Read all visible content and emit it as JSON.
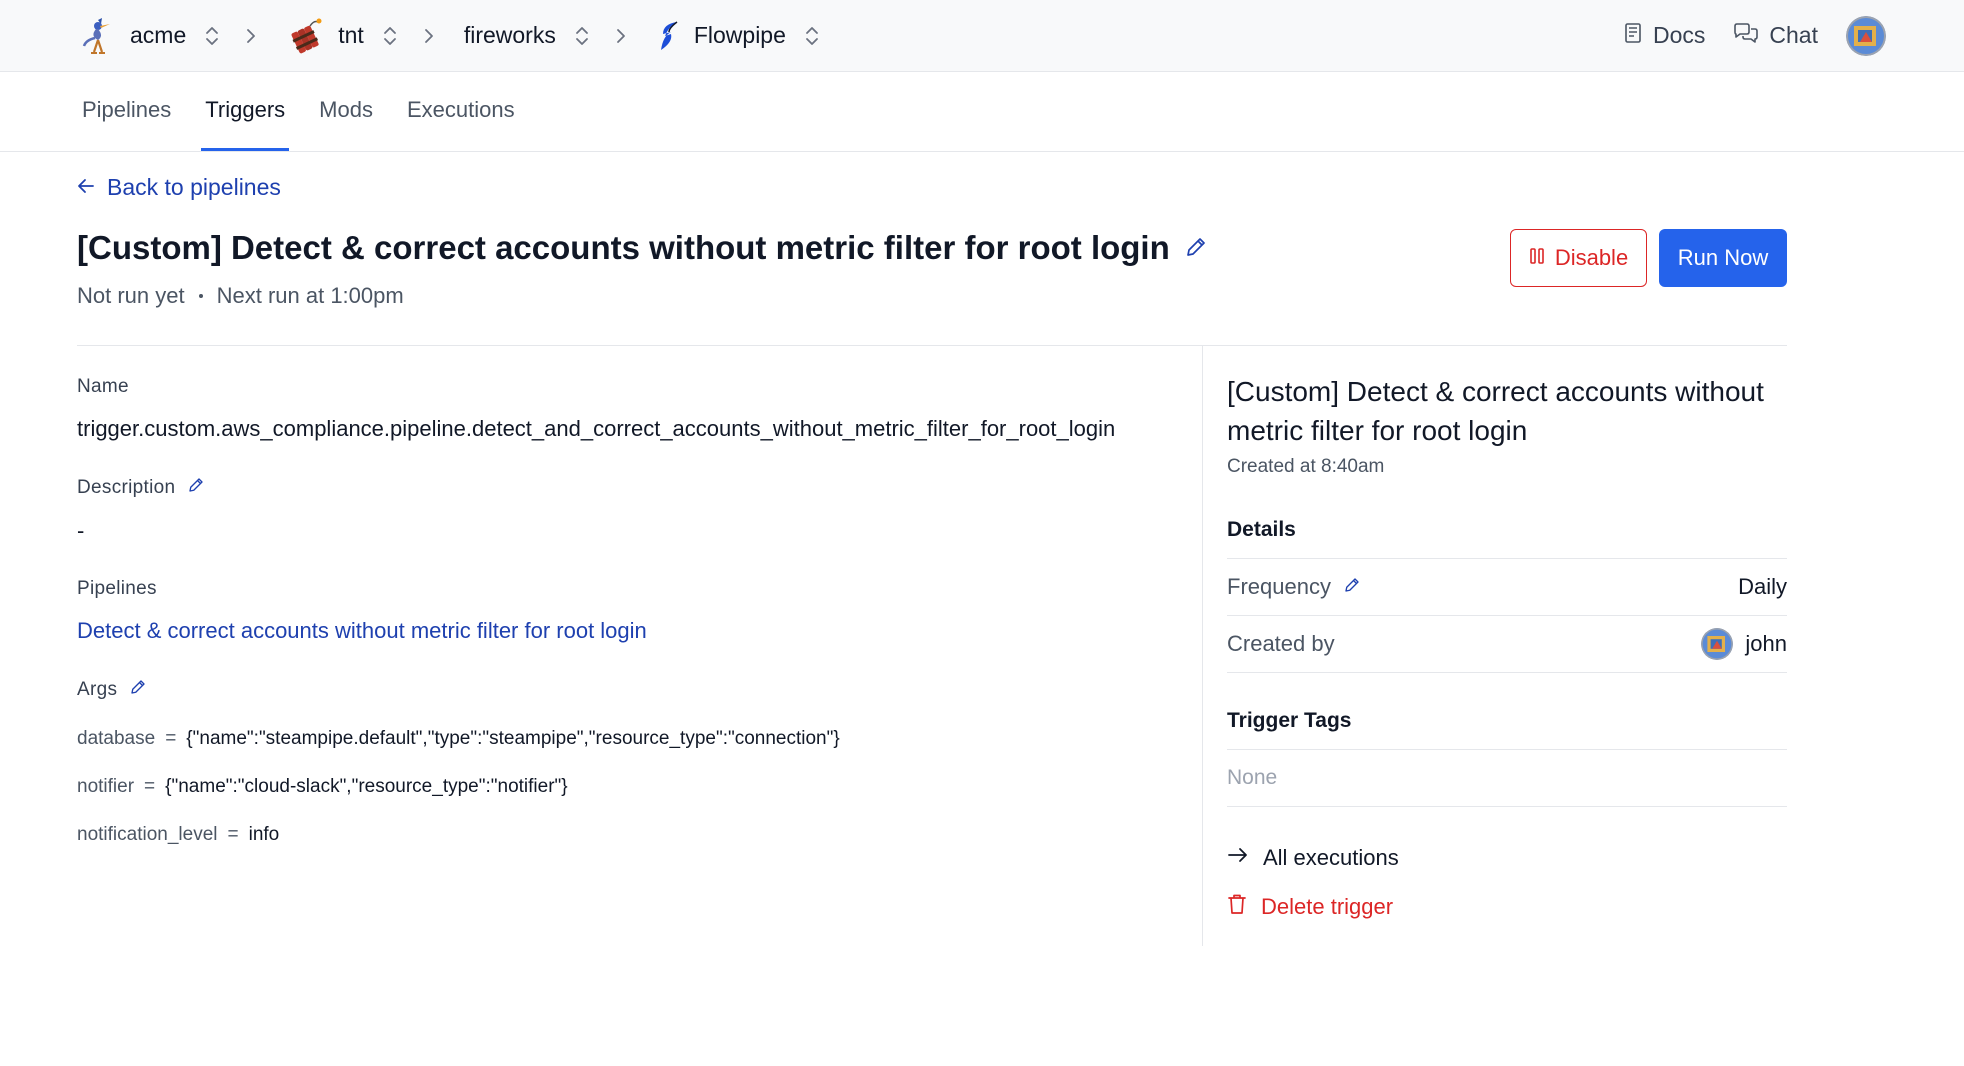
{
  "breadcrumb": {
    "items": [
      {
        "label": "acme",
        "icon": "roadrunner-logo-icon"
      },
      {
        "label": "tnt",
        "icon": "dynamite-logo-icon"
      },
      {
        "label": "fireworks",
        "icon": ""
      },
      {
        "label": "Flowpipe",
        "icon": "flowpipe-logo-icon"
      }
    ]
  },
  "topnav": {
    "docs_label": "Docs",
    "chat_label": "Chat"
  },
  "tabs": [
    {
      "label": "Pipelines",
      "active": false
    },
    {
      "label": "Triggers",
      "active": true
    },
    {
      "label": "Mods",
      "active": false
    },
    {
      "label": "Executions",
      "active": false
    }
  ],
  "page": {
    "back_label": "Back to pipelines",
    "title": "[Custom] Detect & correct accounts without metric filter for root login",
    "status": "Not run yet",
    "next_run": "Next run at 1:00pm",
    "disable_label": "Disable",
    "run_now_label": "Run Now"
  },
  "details": {
    "name_label": "Name",
    "name_value": "trigger.custom.aws_compliance.pipeline.detect_and_correct_accounts_without_metric_filter_for_root_login",
    "description_label": "Description",
    "description_value": "-",
    "pipelines_label": "Pipelines",
    "pipeline_link": "Detect & correct accounts without metric filter for root login",
    "args_label": "Args",
    "args": [
      {
        "key": "database",
        "value": "{\"name\":\"steampipe.default\",\"type\":\"steampipe\",\"resource_type\":\"connection\"}"
      },
      {
        "key": "notifier",
        "value": "{\"name\":\"cloud-slack\",\"resource_type\":\"notifier\"}"
      },
      {
        "key": "notification_level",
        "value": "info"
      }
    ]
  },
  "sidebar": {
    "title": "[Custom] Detect & correct accounts without metric filter for root login",
    "created_at": "Created at 8:40am",
    "details_heading": "Details",
    "frequency_label": "Frequency",
    "frequency_value": "Daily",
    "created_by_label": "Created by",
    "created_by_value": "john",
    "tags_heading": "Trigger Tags",
    "tags_empty": "None",
    "all_executions_label": "All executions",
    "delete_label": "Delete trigger"
  },
  "colors": {
    "accent": "#2563eb",
    "link": "#1e40af",
    "danger": "#dc2626"
  }
}
